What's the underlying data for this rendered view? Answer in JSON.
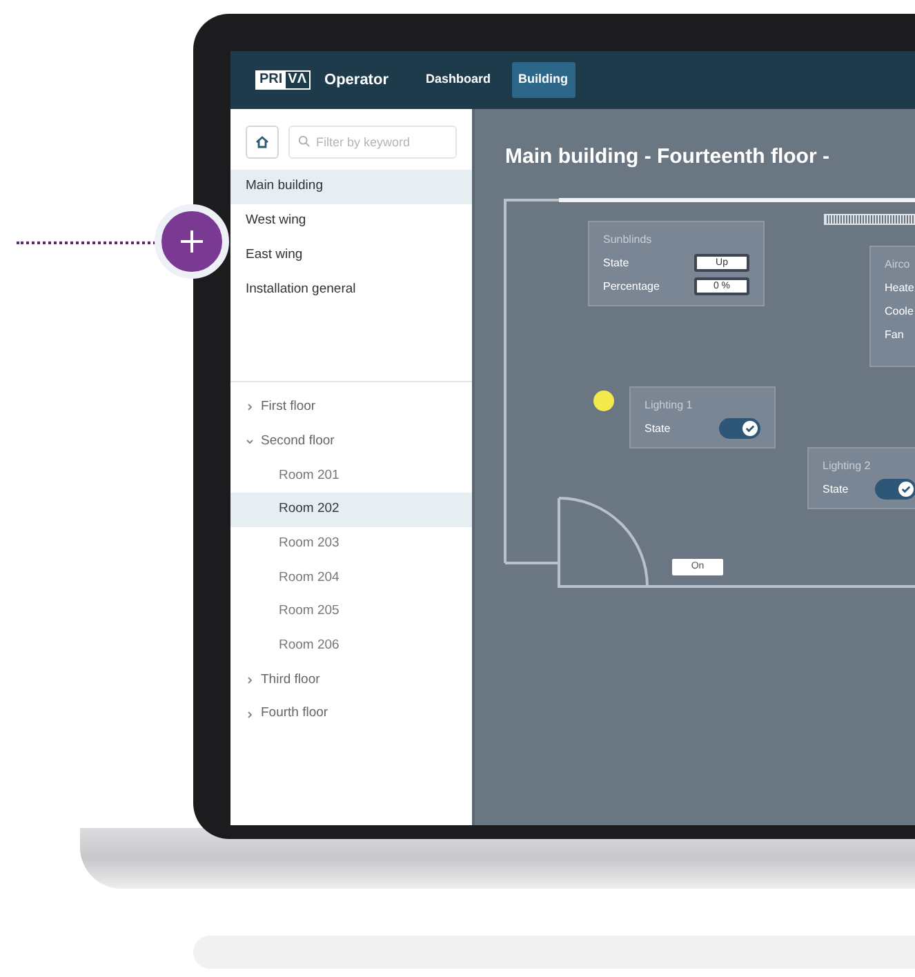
{
  "logo": [
    "PRI",
    "VΛ"
  ],
  "app_name": "Operator",
  "nav_tabs": [
    {
      "label": "Dashboard",
      "selected": false
    },
    {
      "label": "Building",
      "selected": true
    }
  ],
  "sidebar": {
    "search": {
      "placeholder": "Filter by keyword"
    },
    "locations": [
      {
        "label": "Main building",
        "selected": true
      },
      {
        "label": "West wing",
        "selected": false
      },
      {
        "label": "East wing",
        "selected": false
      },
      {
        "label": "Installation general",
        "selected": false
      }
    ],
    "tree": [
      {
        "label": "First floor",
        "expanded": false,
        "selected": false
      },
      {
        "label": "Second floor",
        "expanded": true,
        "selected": false,
        "children": [
          {
            "label": "Room 201",
            "selected": false
          },
          {
            "label": "Room 202",
            "selected": true
          },
          {
            "label": "Room 203",
            "selected": false
          },
          {
            "label": "Room 204",
            "selected": false
          },
          {
            "label": "Room 205",
            "selected": false
          },
          {
            "label": "Room 206",
            "selected": false
          }
        ]
      },
      {
        "label": "Third floor",
        "expanded": false,
        "selected": false
      },
      {
        "label": "Fourth floor",
        "expanded": false,
        "selected": false
      }
    ]
  },
  "floor_plan": {
    "title": "Main building - Fourteenth floor -",
    "lamp": {
      "on": true
    },
    "door_label": "On",
    "widgets": [
      {
        "title": "Sunblinds",
        "rows": [
          {
            "kind": "value",
            "label": "State",
            "value": "Up"
          },
          {
            "kind": "value",
            "label": "Percentage",
            "value": "0 %"
          }
        ]
      },
      {
        "title": "Airco",
        "rows": [
          {
            "kind": "label",
            "label": "Heate"
          },
          {
            "kind": "label",
            "label": "Coole"
          },
          {
            "kind": "label",
            "label": "Fan"
          }
        ]
      },
      {
        "title": "Lighting 1",
        "rows": [
          {
            "kind": "toggle",
            "label": "State",
            "on": true
          }
        ]
      },
      {
        "title": "Lighting 2",
        "rows": [
          {
            "kind": "toggle",
            "label": "State",
            "on": true
          }
        ]
      }
    ]
  }
}
